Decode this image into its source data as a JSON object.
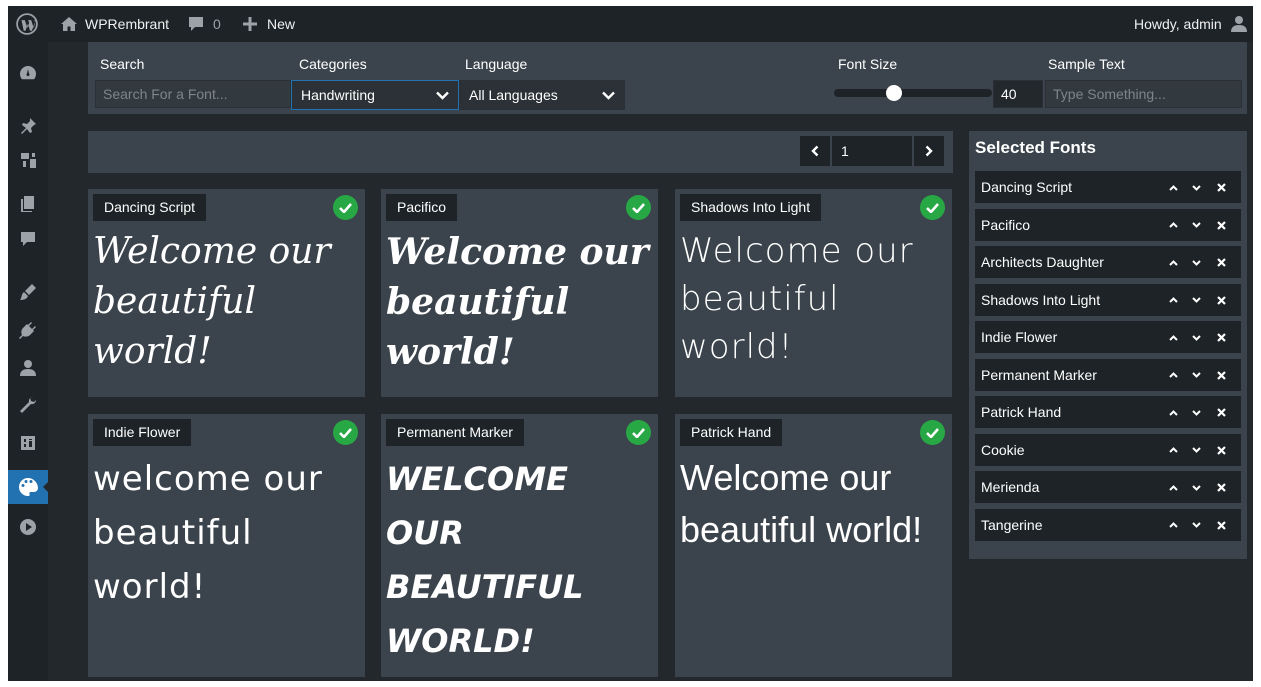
{
  "adminbar": {
    "site_name": "WPRembrant",
    "comments_count": "0",
    "new_label": "New",
    "greeting": "Howdy, admin"
  },
  "sidebar": {
    "icons": [
      "dashboard-icon",
      "pin-icon",
      "media-icon",
      "pages-icon",
      "comments-icon",
      "appearance-icon",
      "plugins-icon",
      "users-icon",
      "tools-icon",
      "settings-icon",
      "fonts-plugin-icon",
      "play-icon"
    ],
    "active": "fonts-plugin-icon"
  },
  "filters": {
    "search_label": "Search",
    "search_placeholder": "Search For a Font...",
    "categories_label": "Categories",
    "categories_value": "Handwriting",
    "language_label": "Language",
    "language_value": "All Languages",
    "font_size_label": "Font Size",
    "font_size_value": "40",
    "font_size_fraction": 0.35,
    "sample_text_label": "Sample Text",
    "sample_text_placeholder": "Type Something..."
  },
  "pagination": {
    "page": "1"
  },
  "cards": [
    {
      "name": "Dancing Script",
      "sample": "Welcome our beautiful world!",
      "selected": true
    },
    {
      "name": "Pacifico",
      "sample": "Welcome our beautiful world!",
      "selected": true
    },
    {
      "name": "Shadows Into Light",
      "sample": "Welcome our beautiful world!",
      "selected": true
    },
    {
      "name": "Indie Flower",
      "sample": "welcome our beautiful world!",
      "selected": true
    },
    {
      "name": "Permanent Marker",
      "sample": "WELCOME OUR BEAUTIFUL WORLD!",
      "selected": true
    },
    {
      "name": "Patrick Hand",
      "sample": "Welcome our beautiful world!",
      "selected": true
    }
  ],
  "selected_fonts": {
    "title": "Selected Fonts",
    "items": [
      "Dancing Script",
      "Pacifico",
      "Architects Daughter",
      "Shadows Into Light",
      "Indie Flower",
      "Permanent Marker",
      "Patrick Hand",
      "Cookie",
      "Merienda",
      "Tangerine"
    ]
  },
  "colors": {
    "bar_bg": "#1d2327",
    "panel_bg": "#3b444c",
    "check_green": "#28a745",
    "active_blue": "#2271b1"
  }
}
